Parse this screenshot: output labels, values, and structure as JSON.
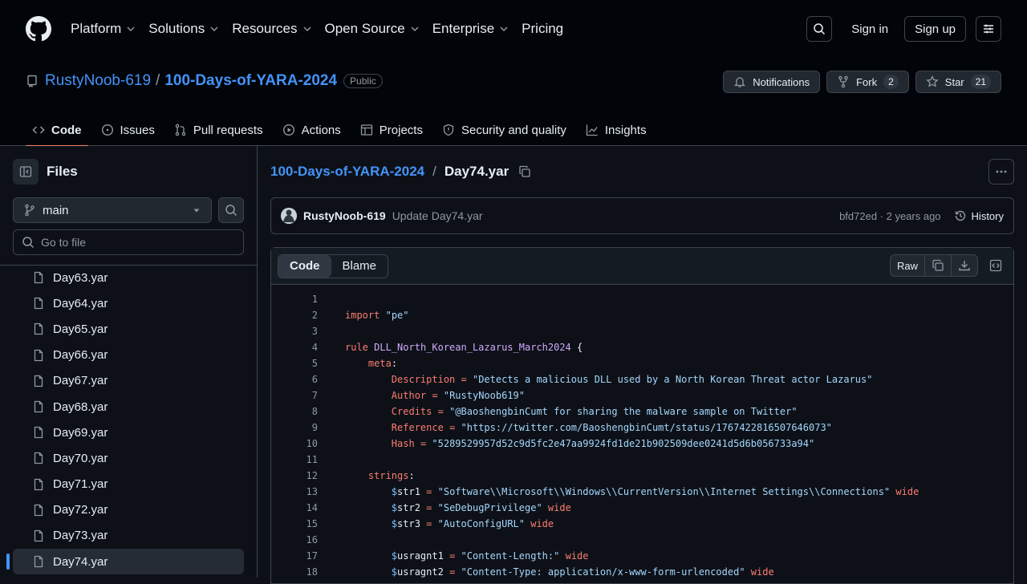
{
  "nav": {
    "items": [
      {
        "label": "Platform",
        "dropdown": true
      },
      {
        "label": "Solutions",
        "dropdown": true
      },
      {
        "label": "Resources",
        "dropdown": true
      },
      {
        "label": "Open Source",
        "dropdown": true
      },
      {
        "label": "Enterprise",
        "dropdown": true
      },
      {
        "label": "Pricing",
        "dropdown": false
      }
    ],
    "sign_in": "Sign in",
    "sign_up": "Sign up"
  },
  "repo": {
    "owner": "RustyNoob-619",
    "separator": "/",
    "name": "100-Days-of-YARA-2024",
    "visibility": "Public",
    "notifications_label": "Notifications",
    "fork_label": "Fork",
    "fork_count": "2",
    "star_label": "Star",
    "star_count": "21"
  },
  "tabs": [
    {
      "label": "Code",
      "icon": "code-icon",
      "active": true
    },
    {
      "label": "Issues",
      "icon": "issue-icon"
    },
    {
      "label": "Pull requests",
      "icon": "pull-request-icon"
    },
    {
      "label": "Actions",
      "icon": "play-icon"
    },
    {
      "label": "Projects",
      "icon": "table-icon"
    },
    {
      "label": "Security and quality",
      "icon": "shield-icon"
    },
    {
      "label": "Insights",
      "icon": "graph-icon"
    }
  ],
  "sidebar": {
    "title": "Files",
    "branch": "main",
    "go_to_file_placeholder": "Go to file",
    "files": [
      "Day63.yar",
      "Day64.yar",
      "Day65.yar",
      "Day66.yar",
      "Day67.yar",
      "Day68.yar",
      "Day69.yar",
      "Day70.yar",
      "Day71.yar",
      "Day72.yar",
      "Day73.yar",
      "Day74.yar"
    ],
    "active_file": "Day74.yar"
  },
  "breadcrumb": {
    "repo": "100-Days-of-YARA-2024",
    "separator": "/",
    "file": "Day74.yar"
  },
  "commit": {
    "author": "RustyNoob-619",
    "message": "Update Day74.yar",
    "meta": "bfd72ed · 2 years ago",
    "history_label": "History"
  },
  "viewer": {
    "code_tab": "Code",
    "blame_tab": "Blame",
    "raw_label": "Raw"
  },
  "code_lines": [
    {
      "n": "1",
      "parts": []
    },
    {
      "n": "2",
      "parts": [
        [
          "kw",
          "import"
        ],
        [
          "t",
          " "
        ],
        [
          "str",
          "\"pe\""
        ]
      ]
    },
    {
      "n": "3",
      "parts": []
    },
    {
      "n": "4",
      "parts": [
        [
          "kw",
          "rule"
        ],
        [
          "t",
          " "
        ],
        [
          "fn",
          "DLL_North_Korean_Lazarus_March2024"
        ],
        [
          "t",
          " {"
        ]
      ]
    },
    {
      "n": "5",
      "parts": [
        [
          "t",
          "    "
        ],
        [
          "kw",
          "meta"
        ],
        [
          "t",
          ":"
        ]
      ]
    },
    {
      "n": "6",
      "parts": [
        [
          "t",
          "        "
        ],
        [
          "kw",
          "Description"
        ],
        [
          "t",
          " "
        ],
        [
          "kw",
          "="
        ],
        [
          "t",
          " "
        ],
        [
          "str",
          "\"Detects a malicious DLL used by a North Korean Threat actor Lazarus\""
        ]
      ]
    },
    {
      "n": "7",
      "parts": [
        [
          "t",
          "        "
        ],
        [
          "kw",
          "Author"
        ],
        [
          "t",
          " "
        ],
        [
          "kw",
          "="
        ],
        [
          "t",
          " "
        ],
        [
          "str",
          "\"RustyNoob619\""
        ]
      ]
    },
    {
      "n": "8",
      "parts": [
        [
          "t",
          "        "
        ],
        [
          "kw",
          "Credits"
        ],
        [
          "t",
          " "
        ],
        [
          "kw",
          "="
        ],
        [
          "t",
          " "
        ],
        [
          "str",
          "\"@BaoshengbinCumt for sharing the malware sample on Twitter\""
        ]
      ]
    },
    {
      "n": "9",
      "parts": [
        [
          "t",
          "        "
        ],
        [
          "kw",
          "Reference"
        ],
        [
          "t",
          " "
        ],
        [
          "kw",
          "="
        ],
        [
          "t",
          " "
        ],
        [
          "str",
          "\"https://twitter.com/BaoshengbinCumt/status/1767422816507646073\""
        ]
      ]
    },
    {
      "n": "10",
      "parts": [
        [
          "t",
          "        "
        ],
        [
          "kw",
          "Hash"
        ],
        [
          "t",
          " "
        ],
        [
          "kw",
          "="
        ],
        [
          "t",
          " "
        ],
        [
          "str",
          "\"5289529957d52c9d5fc2e47aa9924fd1de21b902509dee0241d5d6b056733a94\""
        ]
      ]
    },
    {
      "n": "11",
      "parts": []
    },
    {
      "n": "12",
      "parts": [
        [
          "t",
          "    "
        ],
        [
          "kw",
          "strings"
        ],
        [
          "t",
          ":"
        ]
      ]
    },
    {
      "n": "13",
      "parts": [
        [
          "t",
          "        "
        ],
        [
          "var",
          "$"
        ],
        [
          "t",
          "str1 "
        ],
        [
          "kw",
          "="
        ],
        [
          "t",
          " "
        ],
        [
          "str",
          "\"Software\\\\Microsoft\\\\Windows\\\\CurrentVersion\\\\Internet Settings\\\\Connections\""
        ],
        [
          "t",
          " "
        ],
        [
          "kw",
          "wide"
        ]
      ]
    },
    {
      "n": "14",
      "parts": [
        [
          "t",
          "        "
        ],
        [
          "var",
          "$"
        ],
        [
          "t",
          "str2 "
        ],
        [
          "kw",
          "="
        ],
        [
          "t",
          " "
        ],
        [
          "str",
          "\"SeDebugPrivilege\""
        ],
        [
          "t",
          " "
        ],
        [
          "kw",
          "wide"
        ]
      ]
    },
    {
      "n": "15",
      "parts": [
        [
          "t",
          "        "
        ],
        [
          "var",
          "$"
        ],
        [
          "t",
          "str3 "
        ],
        [
          "kw",
          "="
        ],
        [
          "t",
          " "
        ],
        [
          "str",
          "\"AutoConfigURL\""
        ],
        [
          "t",
          " "
        ],
        [
          "kw",
          "wide"
        ]
      ]
    },
    {
      "n": "16",
      "parts": []
    },
    {
      "n": "17",
      "parts": [
        [
          "t",
          "        "
        ],
        [
          "var",
          "$"
        ],
        [
          "t",
          "usragnt1 "
        ],
        [
          "kw",
          "="
        ],
        [
          "t",
          " "
        ],
        [
          "str",
          "\"Content-Length:\""
        ],
        [
          "t",
          " "
        ],
        [
          "kw",
          "wide"
        ]
      ]
    },
    {
      "n": "18",
      "parts": [
        [
          "t",
          "        "
        ],
        [
          "var",
          "$"
        ],
        [
          "t",
          "usragnt2 "
        ],
        [
          "kw",
          "="
        ],
        [
          "t",
          " "
        ],
        [
          "str",
          "\"Content-Type: application/x-www-form-urlencoded\""
        ],
        [
          "t",
          " "
        ],
        [
          "kw",
          "wide"
        ]
      ]
    }
  ],
  "colors": {
    "bg": "#0d1117",
    "header_bg": "#010409",
    "link": "#4493f8",
    "active_tab_underline": "#f78166",
    "keyword": "#ff7b72",
    "string": "#a5d6ff",
    "function": "#d2a8ff",
    "variable": "#79c0ff"
  }
}
